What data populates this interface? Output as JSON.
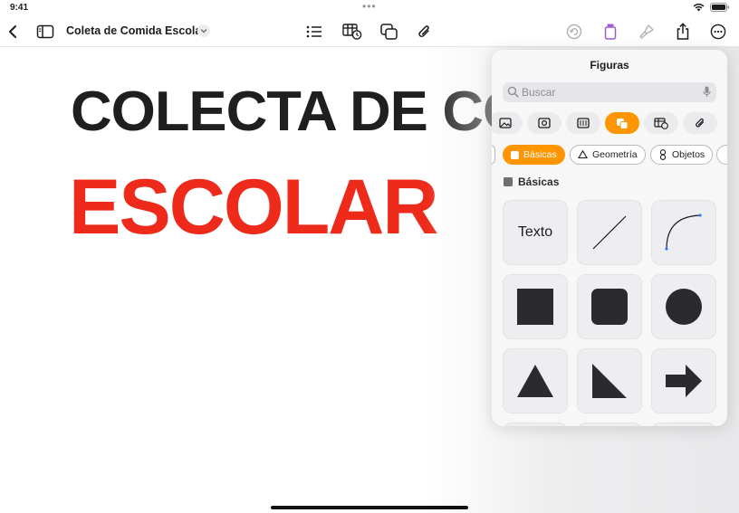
{
  "status": {
    "time": "9:41"
  },
  "toolbar": {
    "title": "Coleta de Comida Escolar",
    "icons": [
      "back-icon",
      "sidebar-icon",
      "title-chevron-icon",
      "list-icon",
      "table-icon",
      "shapes-icon",
      "attachment-icon",
      "undo-icon",
      "shape-tool-icon",
      "format-brush-icon",
      "share-icon",
      "more-icon"
    ]
  },
  "canvas": {
    "line1": "COLECTA DE COMIDA",
    "line2": "ESCOLAR",
    "line1_color": "#1f1f1f",
    "line2_color": "#ee2a1b"
  },
  "popover": {
    "title": "Figuras",
    "search_placeholder": "Buscar",
    "categories": [
      "photo-icon",
      "media-icon",
      "chart-icon",
      "shapes-icon",
      "table-icon",
      "attachment-icon"
    ],
    "active_category": 3,
    "chips": [
      "Básicas",
      "Geometría",
      "Objetos"
    ],
    "active_chip": 0,
    "section_label": "Básicas",
    "tiles": [
      "Texto",
      "line-shape",
      "curve-shape",
      "square-shape",
      "rounded-square-shape",
      "circle-shape",
      "triangle-shape",
      "right-triangle-shape",
      "arrow-shape"
    ]
  },
  "colors": {
    "accent": "#ff9500",
    "shape_fill": "#2b2b2d"
  }
}
